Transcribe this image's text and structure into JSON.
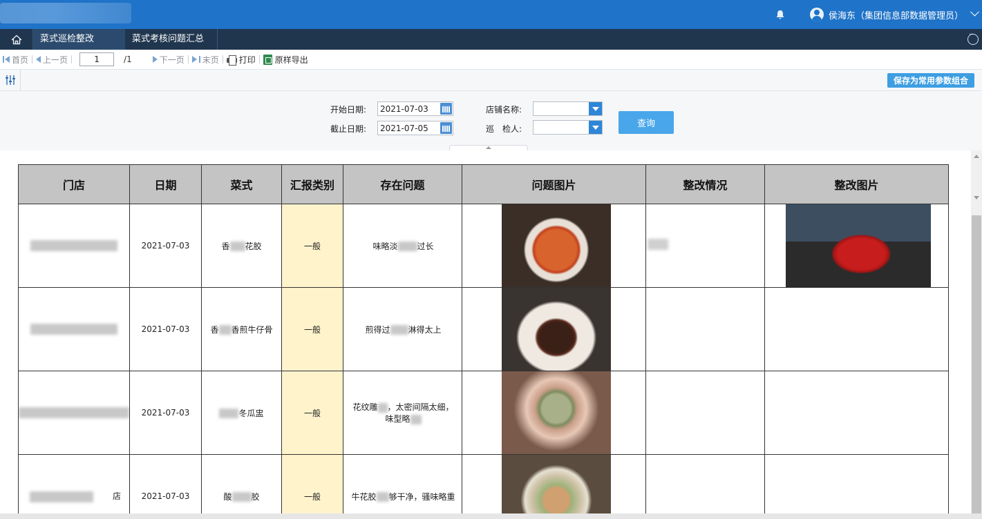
{
  "header": {
    "user_label": "侯海东（集团信息部数据管理员）",
    "colors": {
      "header_bg": "#1f73c8",
      "tabbar_bg": "#20364f",
      "accent": "#3d9ee2"
    }
  },
  "tabs": [
    {
      "label": "菜式巡检整改",
      "active": true
    },
    {
      "label": "菜式考核问题汇总",
      "active": false
    }
  ],
  "toolbar": {
    "first": "首页",
    "prev": "上一页",
    "page_value": "1",
    "page_total": "/1",
    "next": "下一页",
    "last": "末页",
    "print": "打印",
    "export": "原样导出"
  },
  "params": {
    "save_label": "保存为常用参数组合"
  },
  "form": {
    "start_label": "开始日期:",
    "start_value": "2021-07-03",
    "end_label": "截止日期:",
    "end_value": "2021-07-05",
    "store_label": "店铺名称:",
    "inspector_label": "巡　检人:",
    "query_label": "查询"
  },
  "table": {
    "headers": [
      "门店",
      "日期",
      "菜式",
      "汇报类别",
      "存在问题",
      "问题图片",
      "整改情况",
      "整改图片"
    ],
    "rows": [
      {
        "date": "2021-07-03",
        "dish_a": "香",
        "dish_b": "花胶",
        "type": "一般",
        "issue_a": "味略淡",
        "issue_b": "过长"
      },
      {
        "date": "2021-07-03",
        "dish_a": "香",
        "dish_b": "香煎牛仔骨",
        "type": "一般",
        "issue_a": "煎得过",
        "issue_b": "淋得太上"
      },
      {
        "date": "2021-07-03",
        "dish_a": "",
        "dish_b": "冬瓜盅",
        "type": "一般",
        "issue_a": "花纹雕",
        "issue_b": "，太密间隔太细，",
        "issue_c": "味型略"
      },
      {
        "store_tail": "店",
        "date": "2021-07-03",
        "dish_a": "酸",
        "dish_b": "胶",
        "type": "一般",
        "issue_a": "牛花胶",
        "issue_b": "够干净，骚味略重"
      }
    ]
  }
}
